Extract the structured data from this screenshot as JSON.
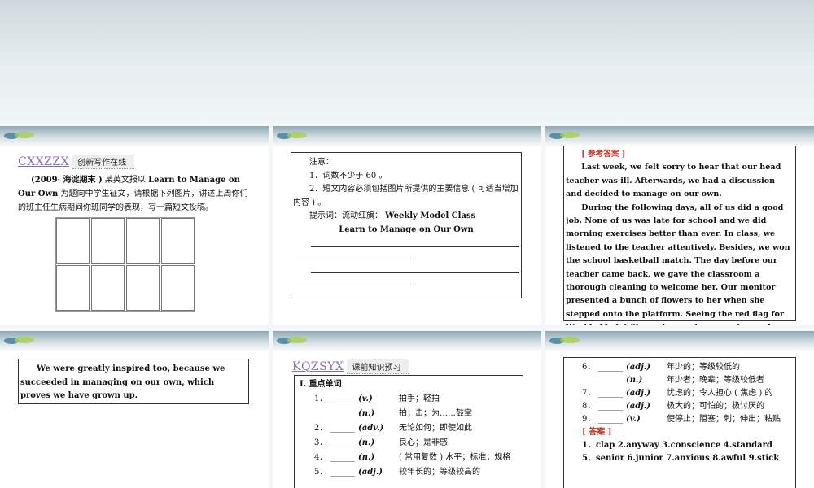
{
  "slide1": {
    "banner_code": "CXXZZX",
    "banner_title": "创新写作在线",
    "source": "(2009· 海淀期末 )",
    "task_a": " 某英文报以 ",
    "task_topic": "Learn to Manage on Our Own",
    "task_b": " 为题向中学生征文，请根据下列图片，讲述上周你们的班主任生病期间你班同学的表现，写一篇短文投稿。"
  },
  "slide2": {
    "note_title": "注意：",
    "note1": "1．词数不少于 60 。",
    "note2": "2．短文内容必须包括图片所提供的主要信息 ( 可适当增加内容 ) 。",
    "hint_label": "提示词：流动红旗：",
    "hint_word": "Weekly Model Class",
    "title_line": "Learn to Manage on Our Own"
  },
  "slide3": {
    "answer_tag": "[ 参考答案 ]",
    "para1": "Last week, we felt sorry to hear that our head teacher was ill. Afterwards, we had a discussion and decided to manage on our own.",
    "para2": "During the following days, all of us did a good job. None of us was late for school and we did morning exercises better than ever. In class, we listened to the teacher attentively. Besides, we won the school basketball match. The day before our teacher came back, we gave the classroom a thorough cleaning to welcome her. Our monitor presented a bunch of flowers to her when she stepped onto the platform. Seeing the red flag for Weekly Model Class, she was happy and moved."
  },
  "slide4": {
    "para": "We were greatly inspired too, because we succeeded in managing on our own, which proves we have grown up."
  },
  "slide5": {
    "banner_code": "KQZSYX",
    "banner_title": "课前知识预习",
    "section": "Ⅰ. 重点单词",
    "items": [
      {
        "num": "1．",
        "blank": "______",
        "pos": "(v.)",
        "meaning": "拍手；轻拍"
      },
      {
        "num": "",
        "blank": "",
        "pos": "(n.)",
        "meaning": "拍；击；为……鼓掌"
      },
      {
        "num": "2．",
        "blank": "______",
        "pos": "(adv.)",
        "meaning": "无论如何；即使如此"
      },
      {
        "num": "3．",
        "blank": "______",
        "pos": "(n.)",
        "meaning": "良心；是非感"
      },
      {
        "num": "4．",
        "blank": "______",
        "pos": "(n.)",
        "meaning": "( 常用复数 ) 水平；标准；规格"
      },
      {
        "num": "5．",
        "blank": "______",
        "pos": "(adj.)",
        "meaning": "较年长的；等级较高的"
      }
    ]
  },
  "slide6": {
    "items": [
      {
        "num": "6．",
        "blank": "______",
        "pos": "(adj.)",
        "meaning": "年少的；等级较低的"
      },
      {
        "num": "",
        "blank": "",
        "pos": "(n.)",
        "meaning": "年少者；晚辈；等级较低者"
      },
      {
        "num": "7．",
        "blank": "______",
        "pos": "(adj.)",
        "meaning": "忧虑的；令人担心 ( 焦虑 ) 的"
      },
      {
        "num": "8．",
        "blank": "______",
        "pos": "(adj.)",
        "meaning": "极大的；可怕的；极讨厌的"
      },
      {
        "num": "9．",
        "blank": "______",
        "pos": "(v.)",
        "meaning": "使停止；阻塞；刺；伸出；粘贴"
      }
    ],
    "answer_tag": "[ 答案 ]",
    "ans1": "1．clap    2.anyway    3.conscience    4.standard",
    "ans2": "5．senior    6.junior    7.anxious    8.awful    9.stick"
  }
}
